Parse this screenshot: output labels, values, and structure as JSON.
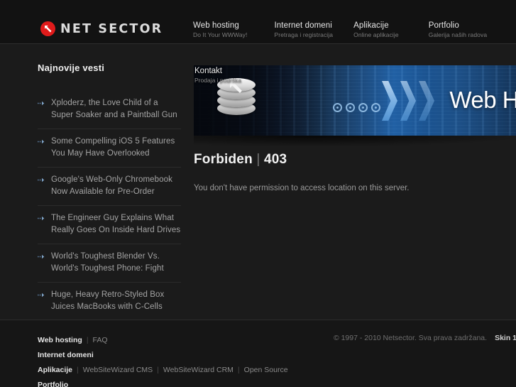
{
  "header": {
    "logo": {
      "text": "NET SECTOR",
      "mark_color": "#e01b1b"
    },
    "nav": [
      {
        "title": "Web hosting",
        "subtitle": "Do It Your WWWay!"
      },
      {
        "title": "Internet domeni",
        "subtitle": "Pretraga i registracija"
      },
      {
        "title": "Aplikacije",
        "subtitle": "Online aplikacije"
      },
      {
        "title": "Portfolio",
        "subtitle": "Galerija naših radova"
      }
    ],
    "nav_overlay": {
      "title": "Kontakt",
      "subtitle": "Prodaja i podrška"
    }
  },
  "sidebar": {
    "title": "Najnovije vesti",
    "items": [
      {
        "text": "Xploderz, the Love Child of a Super Soaker and a Paintball Gun"
      },
      {
        "text": "Some Compelling iOS 5 Features You May Have Overlooked"
      },
      {
        "text": "Google's Web-Only Chromebook Now Available for Pre-Order"
      },
      {
        "text": "The Engineer Guy Explains What Really Goes On Inside Hard Drives"
      },
      {
        "text": "World's Toughest Blender Vs. World's Toughest Phone: Fight"
      },
      {
        "text": "Huge, Heavy Retro-Styled Box Juices MacBooks with C-Cells"
      }
    ]
  },
  "banner": {
    "headline": "Web Ho"
  },
  "content": {
    "title": "Forbiden",
    "title_separator": "|",
    "title_code": "403",
    "message": "You don't have permission to access location on this server."
  },
  "footer": {
    "rows": [
      {
        "main": "Web hosting",
        "links": [
          "FAQ"
        ]
      },
      {
        "main": "Internet domeni",
        "links": []
      },
      {
        "main": "Aplikacije",
        "links": [
          "WebSiteWizard CMS",
          "WebSiteWizard CRM",
          "Open Source"
        ]
      },
      {
        "main": "Portfolio",
        "links": []
      }
    ],
    "copyright": "© 1997 - 2010 Netsector. Sva prava zadržana.",
    "skin": "Skin 1"
  }
}
